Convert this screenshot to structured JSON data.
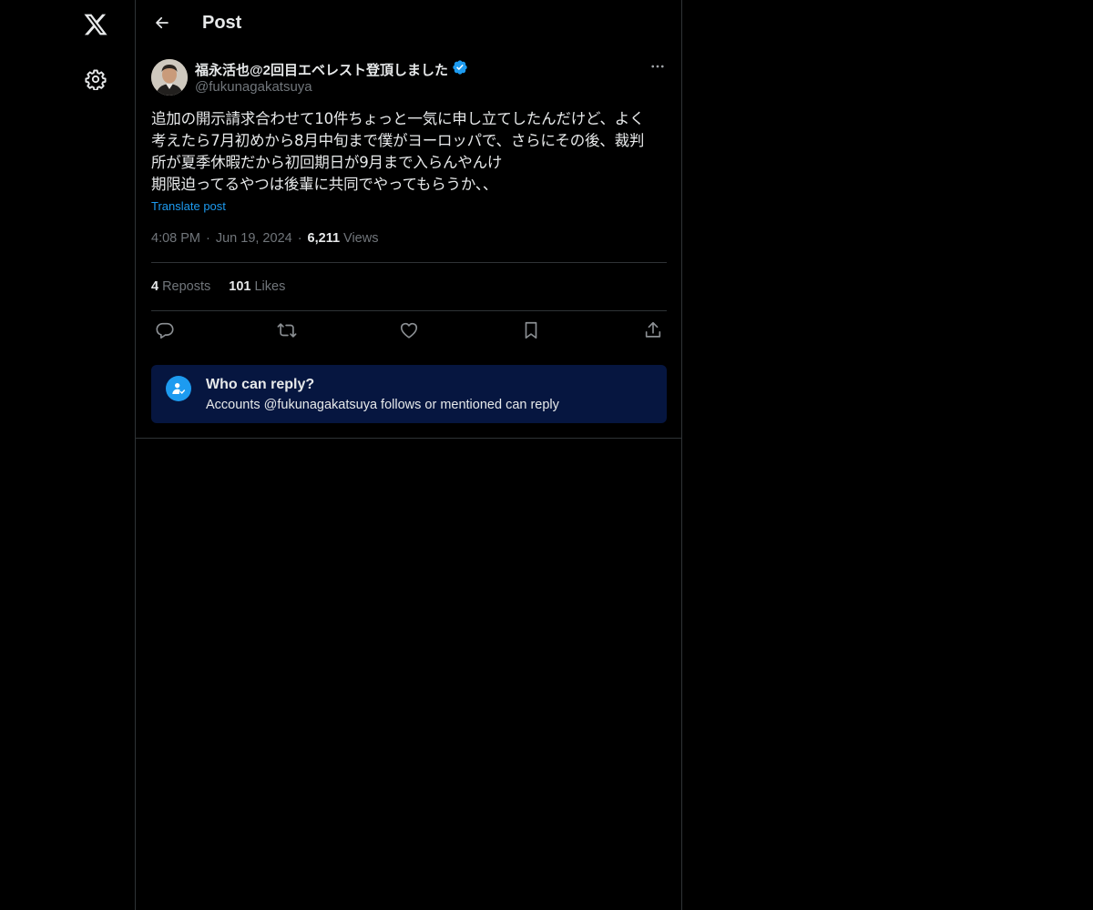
{
  "header": {
    "title": "Post"
  },
  "sidebar": {
    "items": [
      {
        "icon": "x-logo-icon"
      },
      {
        "icon": "gear-icon"
      }
    ]
  },
  "post": {
    "author_name": "福永活也@2回目エベレスト登頂しました",
    "author_handle": "@fukunagakatsuya",
    "verified": true,
    "text": "追加の開示請求合わせて10件ちょっと一気に申し立てしたんだけど、よく\n考えたら7月初めから8月中旬まで僕がヨーロッパで、さらにその後、裁判\n所が夏季休暇だから初回期日が9月まで入らんやんけ\n期限迫ってるやつは後輩に共同でやってもらうか、、",
    "translate_label": "Translate post",
    "time": "4:08 PM",
    "date": "Jun 19, 2024",
    "views_count": "6,211",
    "views_label": "Views",
    "reposts_count": "4",
    "reposts_label": "Reposts",
    "likes_count": "101",
    "likes_label": "Likes"
  },
  "reply_restriction": {
    "title": "Who can reply?",
    "description": "Accounts @fukunagakatsuya follows or mentioned can reply"
  },
  "colors": {
    "background": "#000000",
    "text": "#e7e9ea",
    "muted": "#71767b",
    "accent": "#1d9bf0",
    "reply_box": "#061640",
    "border": "#2f3336"
  }
}
